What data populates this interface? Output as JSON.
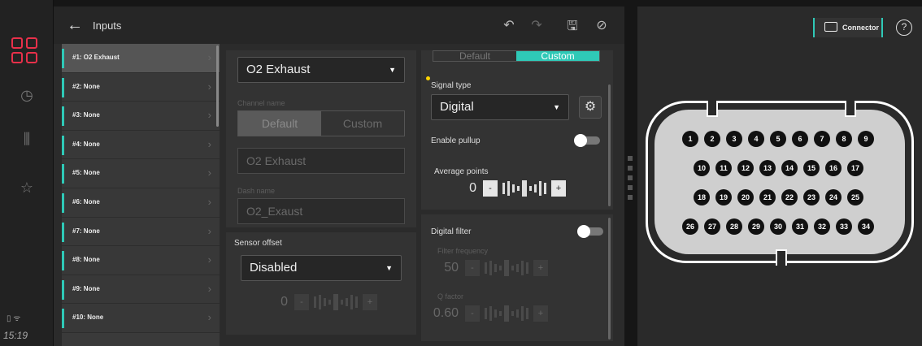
{
  "rail": {
    "items": [
      {
        "name": "dashboard-gauge-icon",
        "glyph": "◷"
      },
      {
        "name": "columns-icon",
        "glyph": "⫼"
      },
      {
        "name": "star-icon",
        "glyph": "☆"
      }
    ],
    "status_icons": "▯ ᯤ",
    "time": "15:19",
    "brand_color": "#e8304a"
  },
  "topbar": {
    "title": "Inputs",
    "back_glyph": "←",
    "undo_glyph": "↶",
    "redo_glyph": "↷",
    "save_glyph": "🖫",
    "cancel_glyph": "⊘"
  },
  "channels": [
    {
      "label": "#1: O2 Exhaust",
      "selected": true
    },
    {
      "label": "#2: None"
    },
    {
      "label": "#3: None"
    },
    {
      "label": "#4: None"
    },
    {
      "label": "#5: None"
    },
    {
      "label": "#6: None"
    },
    {
      "label": "#7: None"
    },
    {
      "label": "#8: None"
    },
    {
      "label": "#9: None"
    },
    {
      "label": "#10: None"
    }
  ],
  "channel_config": {
    "type_value": "O2 Exhaust",
    "channel_name_label": "Channel name",
    "seg_default": "Default",
    "seg_custom": "Custom",
    "channel_name_value": "O2 Exhaust",
    "dash_name_label": "Dash name",
    "dash_name_value": "O2_Exaust"
  },
  "sensor_offset": {
    "label": "Sensor offset",
    "value": "Disabled",
    "stepper_value": "0"
  },
  "signal": {
    "seg_default": "Default",
    "seg_custom": "Custom",
    "signal_type_label": "Signal type",
    "signal_type_value": "Digital",
    "enable_pullup_label": "Enable pullup",
    "average_points_label": "Average points",
    "average_points_value": "0"
  },
  "digital_filter": {
    "label": "Digital filter",
    "filter_frequency_label": "Filter frequency",
    "filter_frequency_value": "50",
    "q_factor_label": "Q factor",
    "q_factor_value": "0.60"
  },
  "stepper_minus": "-",
  "stepper_plus": "+",
  "connector": {
    "button_label": "Connector",
    "help_glyph": "?",
    "row1": [
      "1",
      "2",
      "3",
      "4",
      "5",
      "6",
      "7",
      "8",
      "9"
    ],
    "row2": [
      "10",
      "11",
      "12",
      "13",
      "14",
      "15",
      "16",
      "17"
    ],
    "row3": [
      "18",
      "19",
      "20",
      "21",
      "22",
      "23",
      "24",
      "25"
    ],
    "row4": [
      "26",
      "27",
      "28",
      "29",
      "30",
      "31",
      "32",
      "33",
      "34"
    ]
  },
  "accent_color": "#2fc9b7"
}
